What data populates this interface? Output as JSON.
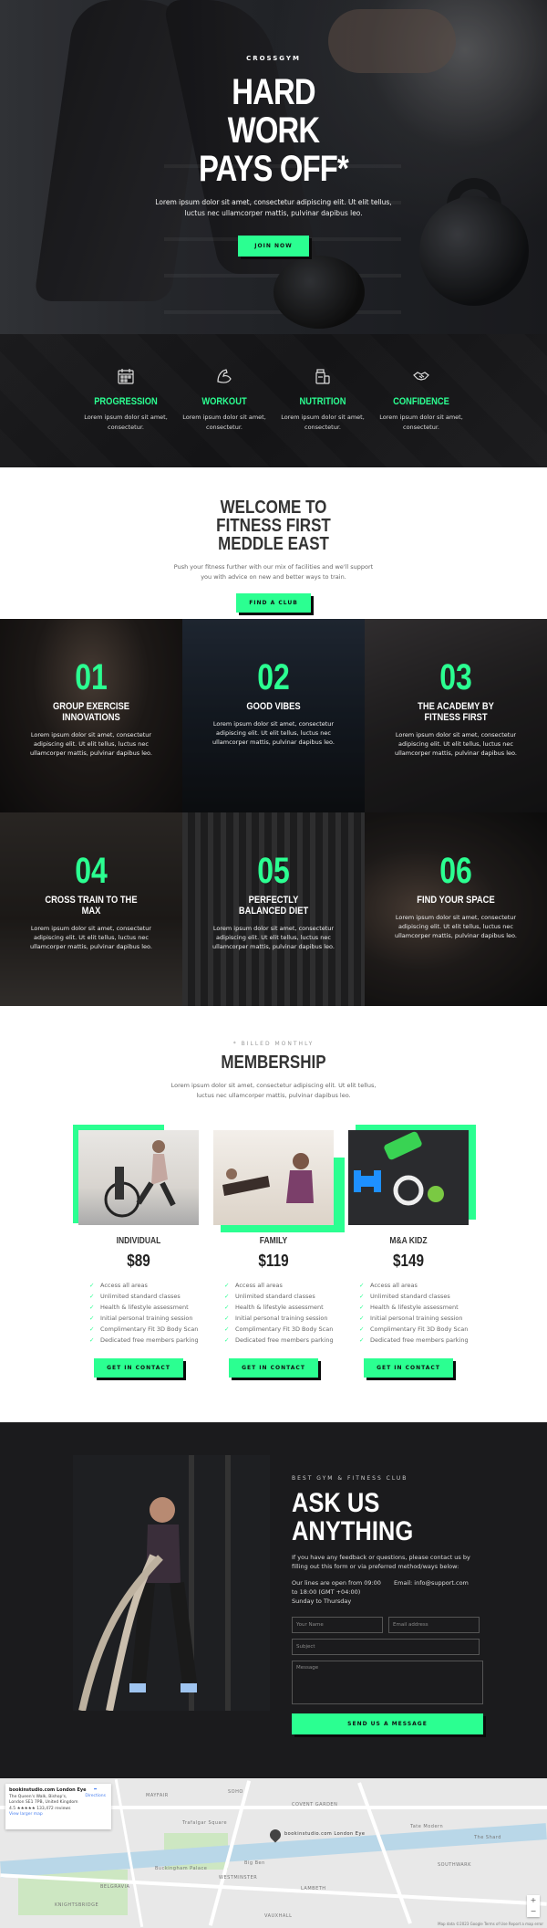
{
  "hero": {
    "eyebrow": "CROSSGYM",
    "title": "HARD WORK PAYS OFF*",
    "text": "Lorem ipsum dolor sit amet, consectetur adipiscing elit. Ut elit tellus, luctus nec ullamcorper mattis, pulvinar dapibus leo.",
    "button": "JOIN NOW"
  },
  "features": [
    {
      "icon": "calendar-icon",
      "title": "PROGRESSION",
      "text": "Lorem ipsum dolor sit amet, consectetur."
    },
    {
      "icon": "flexed-arm-icon",
      "title": "WORKOUT",
      "text": "Lorem ipsum dolor sit amet, consectetur."
    },
    {
      "icon": "supplement-icon",
      "title": "NUTRITION",
      "text": "Lorem ipsum dolor sit amet, consectetur."
    },
    {
      "icon": "handshake-icon",
      "title": "CONFIDENCE",
      "text": "Lorem ipsum dolor sit amet, consectetur."
    }
  ],
  "welcome": {
    "title": "WELCOME TO FITNESS FIRST MEDDLE EAST",
    "text": "Push your fitness further with our mix of facilities and we'll support you with advice on new and better ways to train.",
    "button": "FIND A CLUB"
  },
  "tiles": [
    {
      "num": "01",
      "title": "GROUP EXERCISE INNOVATIONS",
      "text": "Lorem ipsum dolor sit amet, consectetur adipiscing elit. Ut elit tellus, luctus nec ullamcorper mattis, pulvinar dapibus leo."
    },
    {
      "num": "02",
      "title": "GOOD VIBES",
      "text": "Lorem ipsum dolor sit amet, consectetur adipiscing elit. Ut elit tellus, luctus nec ullamcorper mattis, pulvinar dapibus leo."
    },
    {
      "num": "03",
      "title": "THE ACADEMY BY FITNESS FIRST",
      "text": "Lorem ipsum dolor sit amet, consectetur adipiscing elit. Ut elit tellus, luctus nec ullamcorper mattis, pulvinar dapibus leo."
    },
    {
      "num": "04",
      "title": "CROSS TRAIN TO THE MAX",
      "text": "Lorem ipsum dolor sit amet, consectetur adipiscing elit. Ut elit tellus, luctus nec ullamcorper mattis, pulvinar dapibus leo."
    },
    {
      "num": "05",
      "title": "PERFECTLY BALANCED DIET",
      "text": "Lorem ipsum dolor sit amet, consectetur adipiscing elit. Ut elit tellus, luctus nec ullamcorper mattis, pulvinar dapibus leo."
    },
    {
      "num": "06",
      "title": "FIND YOUR SPACE",
      "text": "Lorem ipsum dolor sit amet, consectetur adipiscing elit. Ut elit tellus, luctus nec ullamcorper mattis, pulvinar dapibus leo."
    }
  ],
  "membership": {
    "sub": "* BILLED MONTHLY",
    "title": "MEMBERSHIP",
    "text": "Lorem ipsum dolor sit amet, consectetur adipiscing elit. Ut elit tellus, luctus nec ullamcorper mattis, pulvinar dapibus leo.",
    "plans": [
      {
        "name": "INDIVIDUAL",
        "price": "$89",
        "button": "GET IN CONTACT",
        "features": [
          "Access all areas",
          "Unlimited standard classes",
          "Health & lifestyle assessment",
          "Initial personal training session",
          "Complimentary Fit 3D Body Scan",
          "Dedicated free members parking"
        ]
      },
      {
        "name": "FAMILY",
        "price": "$119",
        "button": "GET IN CONTACT",
        "features": [
          "Access all areas",
          "Unlimited standard classes",
          "Health & lifestyle assessment",
          "Initial personal training session",
          "Complimentary Fit 3D Body Scan",
          "Dedicated free members parking"
        ]
      },
      {
        "name": "M&A KIDZ",
        "price": "$149",
        "button": "GET IN CONTACT",
        "features": [
          "Access all areas",
          "Unlimited standard classes",
          "Health & lifestyle assessment",
          "Initial personal training session",
          "Complimentary Fit 3D Body Scan",
          "Dedicated free members parking"
        ]
      }
    ]
  },
  "contact": {
    "sub": "BEST GYM & FITNESS CLUB",
    "title": "ASK US ANYTHING",
    "text": "If you have any feedback or questions, please contact us by filling out this form or via preferred method/ways below:",
    "hours": "Our lines are open from 09:00 to 18:00 (GMT +04:00) Sunday to Thursday",
    "email": "Email: info@support.com",
    "name_placeholder": "Your Name",
    "email_placeholder": "Email address",
    "subject_placeholder": "Subject",
    "message_placeholder": "Message",
    "send": "SEND US A MESSAGE"
  },
  "map": {
    "place": "bookinstudio.com London Eye",
    "address": "The Queen's Walk, Bishop's, London SE1 7PB, United Kingdom",
    "rating": "4.5 ★★★★★ 133,472 reviews",
    "link": "View larger map",
    "directions": "Directions",
    "pin_label": "bookinstudio.com London Eye",
    "labels": [
      "MAYFAIR",
      "SOHO",
      "COVENT GARDEN",
      "Tate Modern",
      "The Shard",
      "SOUTHWARK",
      "BELGRAVIA",
      "KNIGHTSBRIDGE",
      "WESTMINSTER",
      "LAMBETH",
      "VAUXHALL",
      "Big Ben",
      "Buckingham Palace",
      "Trafalgar Square"
    ],
    "footnote": "Map data ©2023 Google  Terms of Use  Report a map error"
  },
  "colors": {
    "accent": "#2bff91",
    "dark": "#1b1b1d"
  }
}
